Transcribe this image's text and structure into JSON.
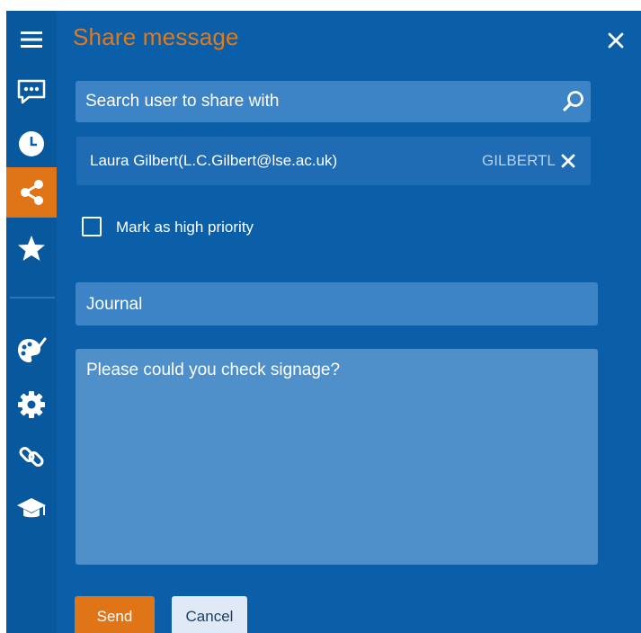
{
  "dialog": {
    "title": "Share message",
    "close_icon": "close-icon"
  },
  "sidebar": {
    "items": [
      {
        "name": "menu",
        "icon": "hamburger-menu-icon"
      },
      {
        "name": "messages",
        "icon": "chat-bubble-icon"
      },
      {
        "name": "history",
        "icon": "clock-icon"
      },
      {
        "name": "share",
        "icon": "share-icon",
        "active": true
      },
      {
        "name": "favorites",
        "icon": "star-icon"
      },
      {
        "name": "appearance",
        "icon": "palette-icon"
      },
      {
        "name": "settings",
        "icon": "gear-icon"
      },
      {
        "name": "links",
        "icon": "link-icon"
      },
      {
        "name": "learning",
        "icon": "graduation-cap-icon"
      }
    ]
  },
  "search": {
    "placeholder": "Search user to share with",
    "value": "",
    "icon": "search-icon"
  },
  "recipient": {
    "name": "Laura Gilbert(L.C.Gilbert@lse.ac.uk)",
    "id": "GILBERTL",
    "remove_icon": "close-icon"
  },
  "priority": {
    "label": "Mark as high priority",
    "checked": false
  },
  "journal": {
    "value": "Journal"
  },
  "message": {
    "text": "Please could you check signage?"
  },
  "actions": {
    "send_label": "Send",
    "cancel_label": "Cancel"
  },
  "colors": {
    "background": "#0a5fa8",
    "sidebar": "#08589d",
    "accent": "#e07518",
    "field": "#3c84c6",
    "cancel_bg": "#dfeaf6"
  }
}
